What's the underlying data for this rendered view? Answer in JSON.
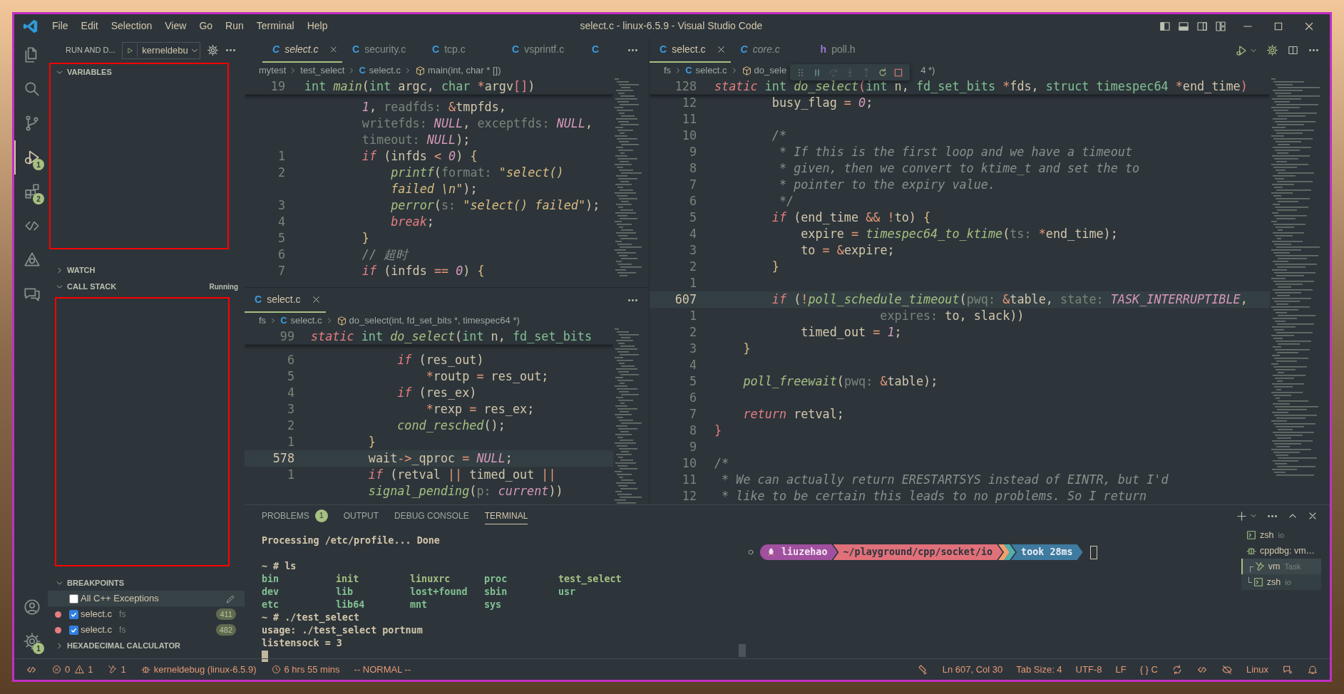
{
  "title_bar": {
    "menus": [
      "File",
      "Edit",
      "Selection",
      "View",
      "Go",
      "Run",
      "Terminal",
      "Help"
    ],
    "title": "select.c - linux-6.5.9 - Visual Studio Code"
  },
  "activity_bar": {
    "top": [
      {
        "kind": "explorer",
        "selected": false
      },
      {
        "kind": "search",
        "selected": false
      },
      {
        "kind": "source_control",
        "selected": false
      },
      {
        "kind": "run_debug",
        "selected": true,
        "badge": "1"
      },
      {
        "kind": "extensions",
        "selected": false,
        "badge": "2"
      },
      {
        "kind": "remote",
        "selected": false
      },
      {
        "kind": "triangle",
        "selected": false
      },
      {
        "kind": "chat",
        "selected": false
      }
    ],
    "bottom": [
      {
        "kind": "account",
        "selected": false
      },
      {
        "kind": "settings",
        "selected": false,
        "badge": "1"
      }
    ]
  },
  "sidebar": {
    "title": "RUN AND D...",
    "configuration": "kerneldebu",
    "sections": [
      {
        "kind": "variables",
        "label": "VARIABLES",
        "expanded": true,
        "framed": true
      },
      {
        "kind": "watch",
        "label": "WATCH",
        "expanded": false,
        "framed": false
      },
      {
        "kind": "call_stack",
        "label": "CALL STACK",
        "expanded": true,
        "framed": true,
        "status": "Running"
      },
      {
        "kind": "breakpoints",
        "label": "BREAKPOINTS",
        "expanded": true,
        "framed": false,
        "items": [
          {
            "kind": "exception",
            "label": "All C++ Exceptions",
            "checked": false,
            "hovered": true
          },
          {
            "kind": "line",
            "label": "select.c",
            "detail": "fs",
            "checked": true,
            "hovered": false,
            "count": "411"
          },
          {
            "kind": "line",
            "label": "select.c",
            "detail": "fs",
            "checked": true,
            "hovered": false,
            "count": "482"
          }
        ]
      },
      {
        "kind": "hex",
        "label": "HEXADECIMAL CALCULATOR",
        "expanded": false,
        "framed": false
      }
    ]
  },
  "editors": [
    {
      "tabs": [
        {
          "glyph": "C",
          "label": "select.c",
          "selected": true,
          "preview": true
        },
        {
          "glyph": "C",
          "label": "security.c",
          "selected": false,
          "preview": false
        },
        {
          "glyph": "C",
          "label": "tcp.c",
          "selected": false,
          "preview": false
        },
        {
          "glyph": "C",
          "label": "vsprintf.c",
          "selected": false,
          "preview": false
        },
        {
          "glyph": "C",
          "selected": false,
          "preview": false
        }
      ],
      "breadcrumbs": [
        {
          "kind": "folder",
          "text": "mytest"
        },
        {
          "kind": "folder",
          "text": "test_select"
        },
        {
          "kind": "file",
          "glyph": "C",
          "text": "select.c"
        },
        {
          "kind": "symbol",
          "text": "main(int, char * [])"
        }
      ],
      "sticky_line": {
        "number": "19",
        "segments": [
          {
            "kind": "type",
            "text": "int "
          },
          {
            "kind": "function",
            "text": "main"
          },
          {
            "kind": "plain",
            "text": "("
          },
          {
            "kind": "type",
            "text": "int"
          },
          {
            "kind": "plain",
            "text": " argc, "
          },
          {
            "kind": "type",
            "text": "char"
          },
          {
            "kind": "operator",
            "text": " *"
          },
          {
            "kind": "plain",
            "text": "argv"
          },
          {
            "kind": "brace_outer",
            "text": "[]"
          },
          {
            "kind": "plain",
            "text": ")"
          }
        ]
      },
      "lines": [
        {
          "segments": [
            {
              "kind": "constant",
              "text": "        1"
            },
            {
              "kind": "plain",
              "text": ", "
            },
            {
              "kind": "hint",
              "text": "readfds: "
            },
            {
              "kind": "operator",
              "text": "&"
            },
            {
              "kind": "plain",
              "text": "tmpfds,"
            }
          ]
        },
        {
          "segments": [
            {
              "kind": "hint",
              "text": "        writefds: "
            },
            {
              "kind": "constant",
              "text": "NULL"
            },
            {
              "kind": "plain",
              "text": ", "
            },
            {
              "kind": "hint",
              "text": "exceptfds: "
            },
            {
              "kind": "constant",
              "text": "NULL"
            },
            {
              "kind": "plain",
              "text": ","
            }
          ]
        },
        {
          "segments": [
            {
              "kind": "hint",
              "text": "        timeout: "
            },
            {
              "kind": "constant",
              "text": "NULL"
            },
            {
              "kind": "plain",
              "text": ");"
            }
          ]
        },
        {
          "number": "1",
          "current": false,
          "segments": [
            {
              "kind": "keyword",
              "text": "        if"
            },
            {
              "kind": "plain",
              "text": " (infds "
            },
            {
              "kind": "operator",
              "text": "<"
            },
            {
              "kind": "constant",
              "text": " 0"
            },
            {
              "kind": "plain",
              "text": ") "
            },
            {
              "kind": "brace",
              "text": "{"
            }
          ]
        },
        {
          "number": "2",
          "current": false,
          "segments": [
            {
              "kind": "function",
              "text": "            printf"
            },
            {
              "kind": "plain",
              "text": "("
            },
            {
              "kind": "hint",
              "text": "format: "
            },
            {
              "kind": "string",
              "text": "\"select()"
            }
          ]
        },
        {
          "segments": [
            {
              "kind": "string",
              "text": "            failed \\n\""
            },
            {
              "kind": "plain",
              "text": ");"
            }
          ]
        },
        {
          "number": "3",
          "current": false,
          "segments": [
            {
              "kind": "function",
              "text": "            perror"
            },
            {
              "kind": "plain",
              "text": "("
            },
            {
              "kind": "hint",
              "text": "s: "
            },
            {
              "kind": "string",
              "text": "\"select() failed\""
            },
            {
              "kind": "plain",
              "text": ");"
            }
          ]
        },
        {
          "number": "4",
          "current": false,
          "segments": [
            {
              "kind": "keyword",
              "text": "            break"
            },
            {
              "kind": "plain",
              "text": ";"
            }
          ]
        },
        {
          "number": "5",
          "current": false,
          "segments": [
            {
              "kind": "brace",
              "text": "        }"
            }
          ]
        },
        {
          "number": "6",
          "current": false,
          "segments": [
            {
              "kind": "comment",
              "text": "        // 超时"
            }
          ]
        },
        {
          "number": "7",
          "current": false,
          "segments": [
            {
              "kind": "keyword",
              "text": "        if"
            },
            {
              "kind": "plain",
              "text": " (infds "
            },
            {
              "kind": "operator",
              "text": "=="
            },
            {
              "kind": "constant",
              "text": " 0"
            },
            {
              "kind": "plain",
              "text": ") "
            },
            {
              "kind": "brace",
              "text": "{"
            }
          ]
        }
      ]
    },
    {
      "tabs": [
        {
          "glyph": "C",
          "label": "select.c",
          "selected": true,
          "preview": false
        }
      ],
      "breadcrumbs": [
        {
          "kind": "folder",
          "text": "fs"
        },
        {
          "kind": "file",
          "glyph": "C",
          "text": "select.c"
        },
        {
          "kind": "symbol",
          "text": "do_select(int, fd_set_bits *, timespec64 *)"
        }
      ],
      "sticky_line": {
        "number": "99",
        "segments": [
          {
            "kind": "keyword",
            "text": "static "
          },
          {
            "kind": "type",
            "text": "int "
          },
          {
            "kind": "function",
            "text": "do_select"
          },
          {
            "kind": "plain",
            "text": "("
          },
          {
            "kind": "type",
            "text": "int"
          },
          {
            "kind": "plain",
            "text": " n, "
          },
          {
            "kind": "type",
            "text": "fd_set_bits"
          }
        ]
      },
      "lines": [
        {
          "number": "6",
          "current": false,
          "segments": [
            {
              "kind": "keyword",
              "text": "            if"
            },
            {
              "kind": "plain",
              "text": " (res_out)"
            }
          ]
        },
        {
          "number": "5",
          "current": false,
          "segments": [
            {
              "kind": "operator",
              "text": "                *"
            },
            {
              "kind": "plain",
              "text": "routp "
            },
            {
              "kind": "operator",
              "text": "="
            },
            {
              "kind": "plain",
              "text": " res_out;"
            }
          ]
        },
        {
          "number": "4",
          "current": false,
          "segments": [
            {
              "kind": "keyword",
              "text": "            if"
            },
            {
              "kind": "plain",
              "text": " (res_ex)"
            }
          ]
        },
        {
          "number": "3",
          "current": false,
          "segments": [
            {
              "kind": "operator",
              "text": "                *"
            },
            {
              "kind": "plain",
              "text": "rexp "
            },
            {
              "kind": "operator",
              "text": "="
            },
            {
              "kind": "plain",
              "text": " res_ex;"
            }
          ]
        },
        {
          "number": "2",
          "current": false,
          "segments": [
            {
              "kind": "function",
              "text": "            cond_resched"
            },
            {
              "kind": "plain",
              "text": "();"
            }
          ]
        },
        {
          "number": "1",
          "current": false,
          "segments": [
            {
              "kind": "brace",
              "text": "        }"
            }
          ]
        },
        {
          "number": "578",
          "current": true,
          "segments": [
            {
              "kind": "plain",
              "text": "        wait"
            },
            {
              "kind": "operator",
              "text": "->"
            },
            {
              "kind": "plain",
              "text": "_qproc "
            },
            {
              "kind": "operator",
              "text": "="
            },
            {
              "kind": "constant",
              "text": " NULL"
            },
            {
              "kind": "plain",
              "text": ";"
            }
          ]
        },
        {
          "number": "1",
          "current": false,
          "segments": [
            {
              "kind": "keyword",
              "text": "        if"
            },
            {
              "kind": "plain",
              "text": " (retval "
            },
            {
              "kind": "operator",
              "text": "||"
            },
            {
              "kind": "plain",
              "text": " timed_out "
            },
            {
              "kind": "operator",
              "text": "||"
            }
          ]
        },
        {
          "segments": [
            {
              "kind": "function",
              "text": "        signal_pending"
            },
            {
              "kind": "plain",
              "text": "("
            },
            {
              "kind": "hint",
              "text": "p: "
            },
            {
              "kind": "constant",
              "text": "current"
            },
            {
              "kind": "plain",
              "text": "))"
            }
          ]
        }
      ]
    },
    {
      "tabs": [
        {
          "glyph": "C",
          "label": "select.c",
          "selected": true,
          "preview": false
        },
        {
          "glyph": "C",
          "label": "core.c",
          "selected": false,
          "preview": true
        },
        {
          "glyph": "h",
          "label": "poll.h",
          "selected": false,
          "preview": false
        }
      ],
      "breadcrumbs": [
        {
          "kind": "folder",
          "text": "fs"
        },
        {
          "kind": "file",
          "glyph": "C",
          "text": "select.c"
        },
        {
          "kind": "symbol",
          "text": "do_sele"
        },
        {
          "kind": "fragment",
          "text": "4 *)"
        }
      ],
      "sticky_line": {
        "number": "128",
        "segments": [
          {
            "kind": "keyword",
            "text": "static "
          },
          {
            "kind": "type",
            "text": "int "
          },
          {
            "kind": "function",
            "text": "do_select"
          },
          {
            "kind": "brace_outer",
            "text": "("
          },
          {
            "kind": "type",
            "text": "int"
          },
          {
            "kind": "plain",
            "text": " n, "
          },
          {
            "kind": "type",
            "text": "fd_set_bits"
          },
          {
            "kind": "operator",
            "text": " *"
          },
          {
            "kind": "plain",
            "text": "fds, "
          },
          {
            "kind": "type",
            "text": "struct timespec64"
          },
          {
            "kind": "operator",
            "text": " *"
          },
          {
            "kind": "plain",
            "text": "end_time"
          },
          {
            "kind": "brace_outer",
            "text": ")"
          }
        ]
      },
      "lines": [
        {
          "number": "12",
          "current": false,
          "segments": [
            {
              "kind": "plain",
              "text": "        busy_flag "
            },
            {
              "kind": "operator",
              "text": "="
            },
            {
              "kind": "constant",
              "text": " 0"
            },
            {
              "kind": "plain",
              "text": ";"
            }
          ]
        },
        {
          "number": "11",
          "current": false
        },
        {
          "number": "10",
          "current": false,
          "segments": [
            {
              "kind": "comment",
              "text": "        /*"
            }
          ]
        },
        {
          "number": "9",
          "current": false,
          "segments": [
            {
              "kind": "comment",
              "text": "         * If this is the first loop and we have a timeout"
            }
          ]
        },
        {
          "number": "8",
          "current": false,
          "segments": [
            {
              "kind": "comment",
              "text": "         * given, then we convert to ktime_t and set the to"
            }
          ]
        },
        {
          "number": "7",
          "current": false,
          "segments": [
            {
              "kind": "comment",
              "text": "         * pointer to the expiry value."
            }
          ]
        },
        {
          "number": "6",
          "current": false,
          "segments": [
            {
              "kind": "comment",
              "text": "         */"
            }
          ]
        },
        {
          "number": "5",
          "current": false,
          "segments": [
            {
              "kind": "keyword",
              "text": "        if"
            },
            {
              "kind": "plain",
              "text": " (end_time "
            },
            {
              "kind": "operator",
              "text": "&&"
            },
            {
              "kind": "operator",
              "text": " !"
            },
            {
              "kind": "plain",
              "text": "to) "
            },
            {
              "kind": "brace",
              "text": "{"
            }
          ]
        },
        {
          "number": "4",
          "current": false,
          "segments": [
            {
              "kind": "plain",
              "text": "            expire "
            },
            {
              "kind": "operator",
              "text": "="
            },
            {
              "kind": "function",
              "text": " timespec64_to_ktime"
            },
            {
              "kind": "plain",
              "text": "("
            },
            {
              "kind": "hint",
              "text": "ts: "
            },
            {
              "kind": "operator",
              "text": "*"
            },
            {
              "kind": "plain",
              "text": "end_time);"
            }
          ]
        },
        {
          "number": "3",
          "current": false,
          "segments": [
            {
              "kind": "plain",
              "text": "            to "
            },
            {
              "kind": "operator",
              "text": "="
            },
            {
              "kind": "operator",
              "text": " &"
            },
            {
              "kind": "plain",
              "text": "expire;"
            }
          ]
        },
        {
          "number": "2",
          "current": false,
          "segments": [
            {
              "kind": "brace",
              "text": "        }"
            }
          ]
        },
        {
          "number": "1",
          "current": false
        },
        {
          "number": "607",
          "current": true,
          "segments": [
            {
              "kind": "keyword",
              "text": "        if"
            },
            {
              "kind": "plain",
              "text": " ("
            },
            {
              "kind": "operator",
              "text": "!"
            },
            {
              "kind": "function",
              "text": "poll_schedule_timeout"
            },
            {
              "kind": "plain",
              "text": "("
            },
            {
              "kind": "hint",
              "text": "pwq: "
            },
            {
              "kind": "operator",
              "text": "&"
            },
            {
              "kind": "plain",
              "text": "table, "
            },
            {
              "kind": "hint",
              "text": "state: "
            },
            {
              "kind": "constant",
              "text": "TASK_INTERRUPTIBLE"
            },
            {
              "kind": "plain",
              "text": ","
            }
          ]
        },
        {
          "number": "1",
          "current": false,
          "segments": [
            {
              "kind": "hint",
              "text": "                       expires: "
            },
            {
              "kind": "plain",
              "text": "to, slack))"
            }
          ]
        },
        {
          "number": "2",
          "current": false,
          "segments": [
            {
              "kind": "plain",
              "text": "            timed_out "
            },
            {
              "kind": "operator",
              "text": "="
            },
            {
              "kind": "constant",
              "text": " 1"
            },
            {
              "kind": "plain",
              "text": ";"
            }
          ]
        },
        {
          "number": "3",
          "current": false,
          "segments": [
            {
              "kind": "brace",
              "text": "    }"
            }
          ]
        },
        {
          "number": "4",
          "current": false
        },
        {
          "number": "5",
          "current": false,
          "segments": [
            {
              "kind": "function",
              "text": "    poll_freewait"
            },
            {
              "kind": "plain",
              "text": "("
            },
            {
              "kind": "hint",
              "text": "pwq: "
            },
            {
              "kind": "operator",
              "text": "&"
            },
            {
              "kind": "plain",
              "text": "table);"
            }
          ]
        },
        {
          "number": "6",
          "current": false
        },
        {
          "number": "7",
          "current": false,
          "segments": [
            {
              "kind": "keyword",
              "text": "    return"
            },
            {
              "kind": "plain",
              "text": " retval;"
            }
          ]
        },
        {
          "number": "8",
          "current": false,
          "segments": [
            {
              "kind": "brace_outer",
              "text": "}"
            }
          ]
        },
        {
          "number": "9",
          "current": false
        },
        {
          "number": "10",
          "current": false,
          "segments": [
            {
              "kind": "comment",
              "text": "/*"
            }
          ]
        },
        {
          "number": "11",
          "current": false,
          "segments": [
            {
              "kind": "comment",
              "text": " * We can actually return ERESTARTSYS instead of EINTR, but I'd"
            }
          ]
        },
        {
          "number": "12",
          "current": false,
          "segments": [
            {
              "kind": "comment",
              "text": " * like to be certain this leads to no problems. So I return"
            }
          ]
        }
      ]
    }
  ],
  "debug_toolbar": [
    {
      "kind": "grip",
      "disabled": false
    },
    {
      "kind": "pause",
      "disabled": false
    },
    {
      "kind": "step_over",
      "disabled": true
    },
    {
      "kind": "step_into",
      "disabled": true
    },
    {
      "kind": "step_out",
      "disabled": true
    },
    {
      "kind": "restart",
      "disabled": false
    },
    {
      "kind": "stop",
      "disabled": false
    }
  ],
  "panel": {
    "tabs": [
      {
        "label": "PROBLEMS",
        "badge": "1",
        "selected": false
      },
      {
        "label": "OUTPUT",
        "selected": false
      },
      {
        "label": "DEBUG CONSOLE",
        "selected": false
      },
      {
        "label": "TERMINAL",
        "selected": true
      }
    ],
    "terminal_output": [
      {
        "kind": "text",
        "text": "Processing /etc/profile... Done"
      },
      {
        "kind": "blank"
      },
      {
        "kind": "text",
        "text": "~ # ls"
      },
      {
        "kind": "listing",
        "entries": [
          {
            "name": "bin",
            "color": "#83c092"
          },
          {
            "name": "init",
            "color": "#a7c080"
          },
          {
            "name": "linuxrc",
            "color": "#a7c080"
          },
          {
            "name": "proc",
            "color": "#83c092"
          },
          {
            "name": "test_select",
            "color": "#a7c080"
          },
          {
            "name": "dev",
            "color": "#83c092"
          },
          {
            "name": "lib",
            "color": "#83c092"
          },
          {
            "name": "lost+found",
            "color": "#83c092"
          },
          {
            "name": "sbin",
            "color": "#83c092"
          },
          {
            "name": "usr",
            "color": "#83c092"
          },
          {
            "name": "etc",
            "color": "#83c092"
          },
          {
            "name": "lib64",
            "color": "#83c092"
          },
          {
            "name": "mnt",
            "color": "#83c092"
          },
          {
            "name": "sys",
            "color": "#83c092"
          }
        ]
      },
      {
        "kind": "text",
        "text": "~ # ./test_select"
      },
      {
        "kind": "text",
        "text": "usage: ./test_select portnum"
      },
      {
        "kind": "text",
        "text": "listensock = 3"
      },
      {
        "kind": "cursor"
      }
    ],
    "prompt": [
      {
        "kind": "user",
        "text": "liuzehao"
      },
      {
        "kind": "path",
        "text": "~/playground/cpp/socket/io"
      },
      {
        "kind": "duration",
        "text": "took 28ms"
      }
    ],
    "terminals": [
      {
        "kind": "shell",
        "label": "zsh",
        "detail": "io",
        "selected": false
      },
      {
        "kind": "debug",
        "label": "cppdbg: vm…",
        "selected": false
      },
      {
        "kind": "task",
        "tree": "┌",
        "label": "vm",
        "detail": "Task",
        "selected": true
      },
      {
        "kind": "shell",
        "tree": "└",
        "label": "zsh",
        "detail": "io",
        "selected": false
      }
    ]
  },
  "status_bar": {
    "left": [
      {
        "kind": "remote"
      },
      {
        "kind": "problems",
        "errors": "0",
        "warnings": "1"
      },
      {
        "kind": "tasks",
        "text": "1"
      },
      {
        "kind": "debug",
        "text": "kerneldebug (linux-6.5.9)"
      },
      {
        "kind": "history",
        "text": "6 hrs 55 mins"
      },
      {
        "kind": "plain",
        "text": "-- NORMAL --"
      }
    ],
    "right": [
      {
        "kind": "brush"
      },
      {
        "kind": "plain",
        "text": "Ln 607, Col 30"
      },
      {
        "kind": "plain",
        "text": "Tab Size: 4"
      },
      {
        "kind": "plain",
        "text": "UTF-8"
      },
      {
        "kind": "plain",
        "text": "LF"
      },
      {
        "kind": "plain",
        "text": "{ } C"
      },
      {
        "kind": "sync"
      },
      {
        "kind": "remote"
      },
      {
        "kind": "slashed"
      },
      {
        "kind": "plain",
        "text": "Linux"
      },
      {
        "kind": "feedback"
      },
      {
        "kind": "bell"
      }
    ]
  }
}
